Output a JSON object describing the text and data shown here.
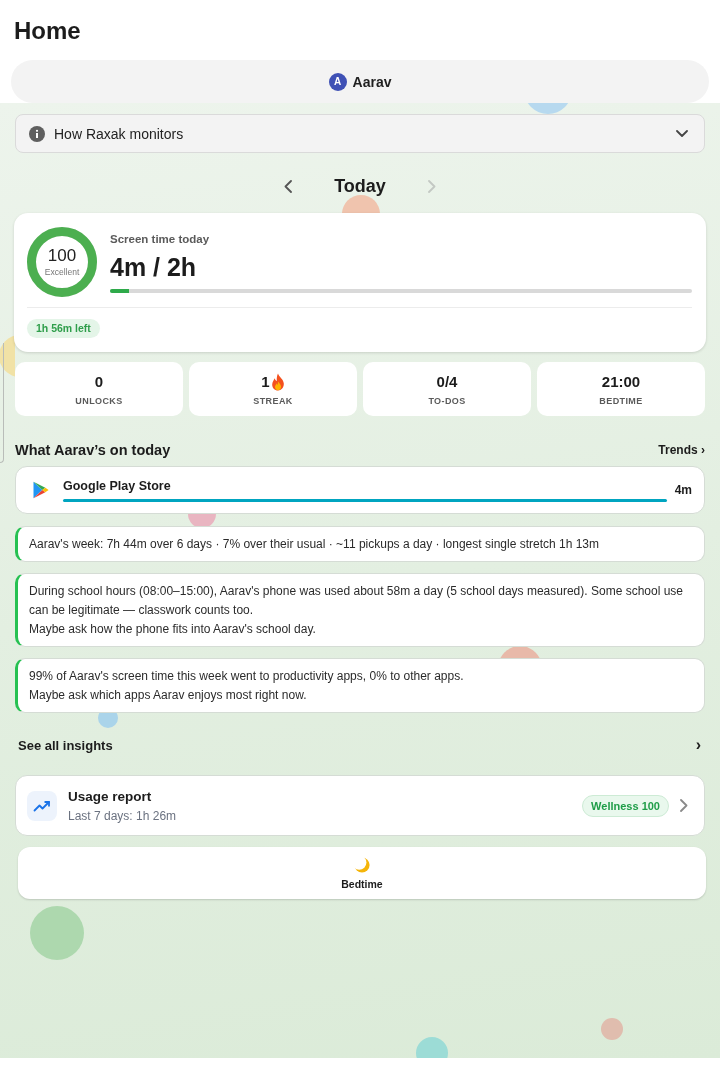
{
  "header": {
    "title": "Home"
  },
  "profile": {
    "initial": "A",
    "name": "Aarav"
  },
  "info": {
    "label": "How Raxak monitors",
    "expanded": false
  },
  "date_nav": {
    "label": "Today",
    "prev": {
      "disabled": false
    },
    "next": {
      "disabled": true
    }
  },
  "screen_time": {
    "score_ring": {
      "level": 1,
      "score": "100",
      "rating": "Excellent"
    },
    "title": "Screen time today",
    "value": "4m / 2h",
    "usage": {
      "level": 0.033
    },
    "remaining": "1h 56m left"
  },
  "stats": [
    {
      "kind": "plain",
      "value": "0",
      "label": "UNLOCKS"
    },
    {
      "kind": "streak",
      "value": "1",
      "label": "STREAK"
    },
    {
      "kind": "plain",
      "value": "0/4",
      "label": "TO-DOS"
    },
    {
      "kind": "plain",
      "value": "21:00",
      "label": "BEDTIME"
    }
  ],
  "activity": {
    "title": "What Aarav’s on today",
    "link": "Trends ›",
    "apps": [
      {
        "name": "Google Play Store",
        "time": "4m"
      }
    ]
  },
  "insights": [
    {
      "text": "Aarav's week: 7h 44m over 6 days · 7% over their usual · ~11 pickups a day · longest single stretch 1h 13m"
    },
    {
      "text": "During school hours (08:00–15:00), Aarav's phone was used about 58m a day (5 school days measured). Some school use can be legitimate — classwork counts too.",
      "prompt": "Maybe ask how the phone fits into Aarav's school day."
    },
    {
      "text": "99% of Aarav's screen time this week went to productivity apps, 0% to other apps.",
      "prompt": "Maybe ask which apps Aarav enjoys most right now."
    }
  ],
  "see_all": {
    "label": "See all insights",
    "chevron": "›"
  },
  "report": {
    "title": "Usage report",
    "subtitle": "Last 7 days: 1h 26m",
    "badge": "Wellness 100"
  },
  "bedtime": {
    "label": "Bedtime"
  }
}
